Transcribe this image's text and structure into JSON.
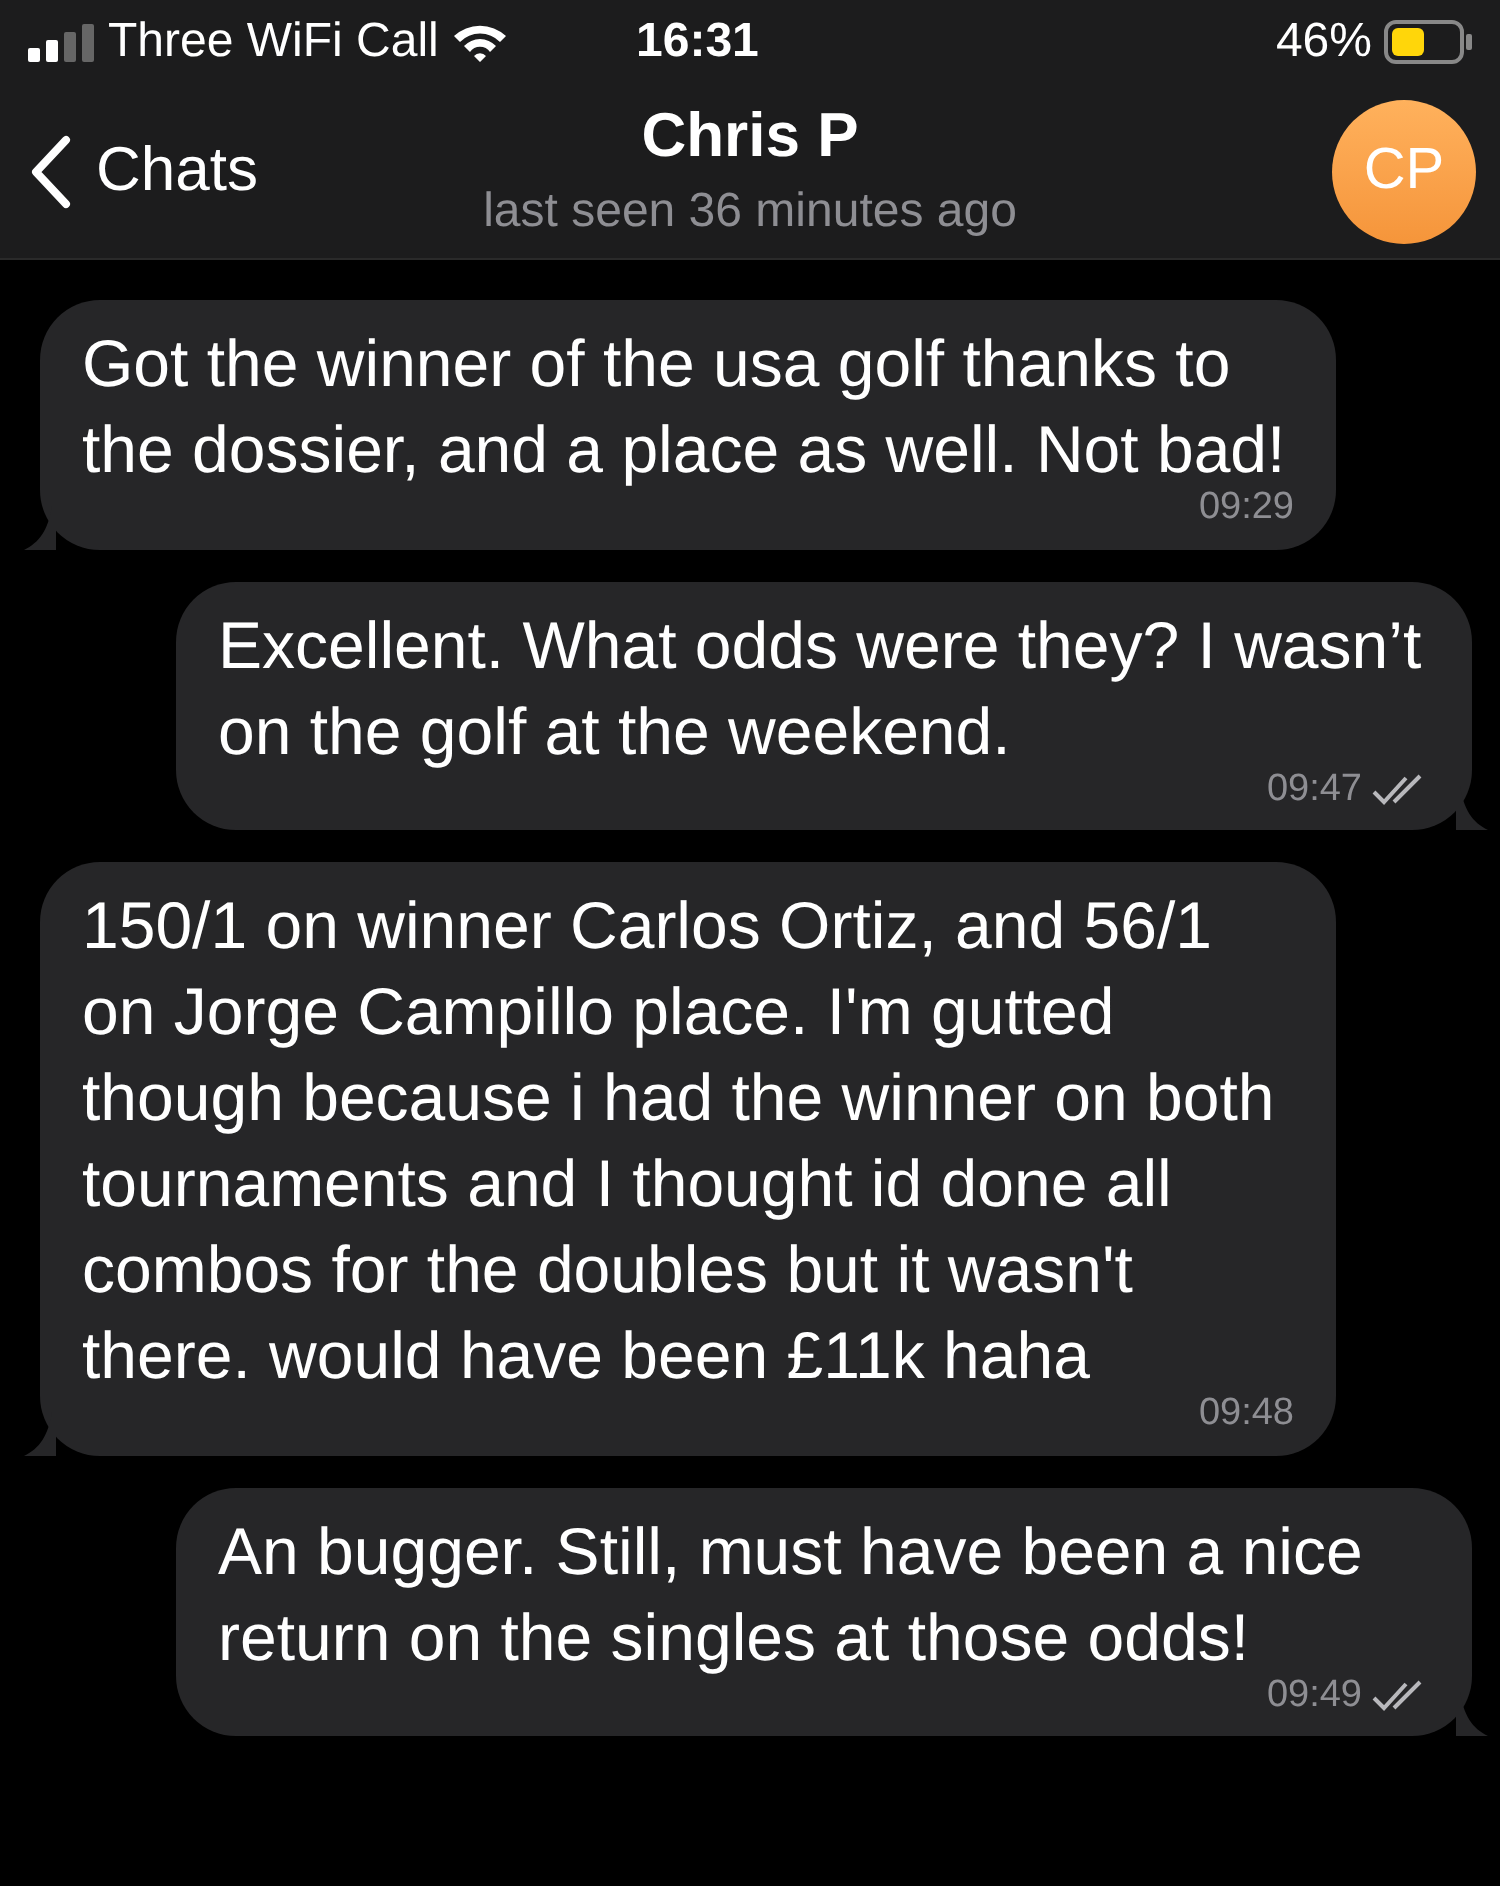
{
  "status_bar": {
    "carrier": "Three WiFi Call",
    "time": "16:31",
    "battery": "46%"
  },
  "header": {
    "back": "Chats",
    "title": "Chris P",
    "subtitle": "last seen 36 minutes ago",
    "avatar": "CP"
  },
  "messages": [
    {
      "kind": "in",
      "text": "Got the winner of the usa golf thanks to the dossier, and a place as well. Not bad!",
      "time": "09:29"
    },
    {
      "kind": "out",
      "text": "Excellent. What odds were they? I wasn’t on the golf at the weekend.",
      "time": "09:47",
      "read": true
    },
    {
      "kind": "in",
      "text": "150/1 on winner Carlos Ortiz, and 56/1 on Jorge Campillo place. I'm gutted though because i had the winner on both tournaments and I thought id done all combos for the doubles but it wasn't there. would have been £11k haha",
      "time": "09:48"
    },
    {
      "kind": "out",
      "text": "An bugger. Still, must have been a nice return on the singles at those odds!",
      "time": "09:49",
      "read": true
    }
  ]
}
